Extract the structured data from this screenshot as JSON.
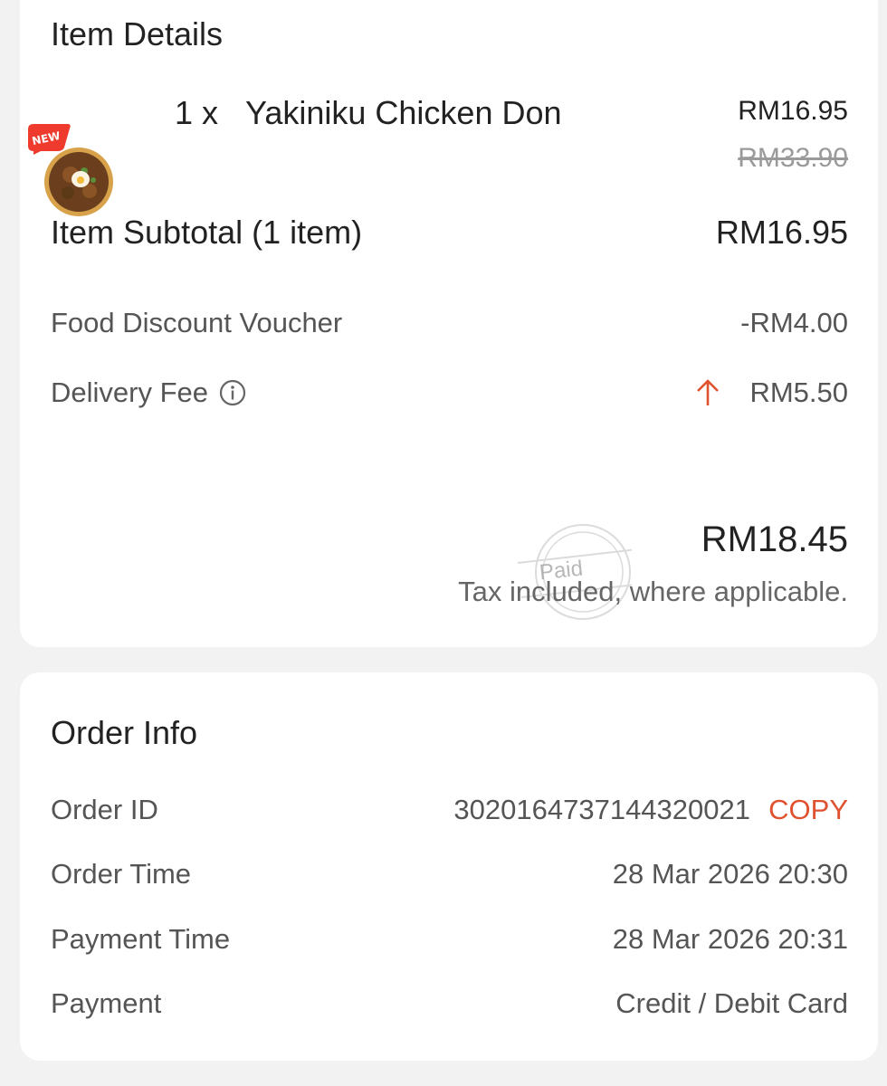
{
  "item_details": {
    "title": "Item Details",
    "item": {
      "badge": "NEW",
      "image_icon": "rice-bowl-image",
      "quantity": "1 x",
      "name": "Yakiniku Chicken Don",
      "price": "RM16.95",
      "original_price": "RM33.90"
    },
    "subtotal_label": "Item Subtotal (1 item)",
    "subtotal_value": "RM16.95",
    "discount_label": "Food Discount Voucher",
    "discount_value": "-RM4.00",
    "delivery_label": "Delivery Fee",
    "delivery_info_icon": "info-icon",
    "delivery_trend_icon": "arrow-up-icon",
    "delivery_value": "RM5.50",
    "stamp_text": "Paid",
    "total_value": "RM18.45",
    "tax_note": "Tax included, where applicable."
  },
  "order_info": {
    "title": "Order Info",
    "order_id_label": "Order ID",
    "order_id_value": "3020164737144320021",
    "copy_label": "COPY",
    "order_time_label": "Order Time",
    "order_time_value": "28 Mar 2026 20:30",
    "payment_time_label": "Payment Time",
    "payment_time_value": "28 Mar 2026 20:31",
    "payment_label": "Payment",
    "payment_value": "Credit / Debit Card"
  },
  "colors": {
    "accent": "#e0522f",
    "background": "#f2f2f2",
    "card": "#ffffff"
  }
}
